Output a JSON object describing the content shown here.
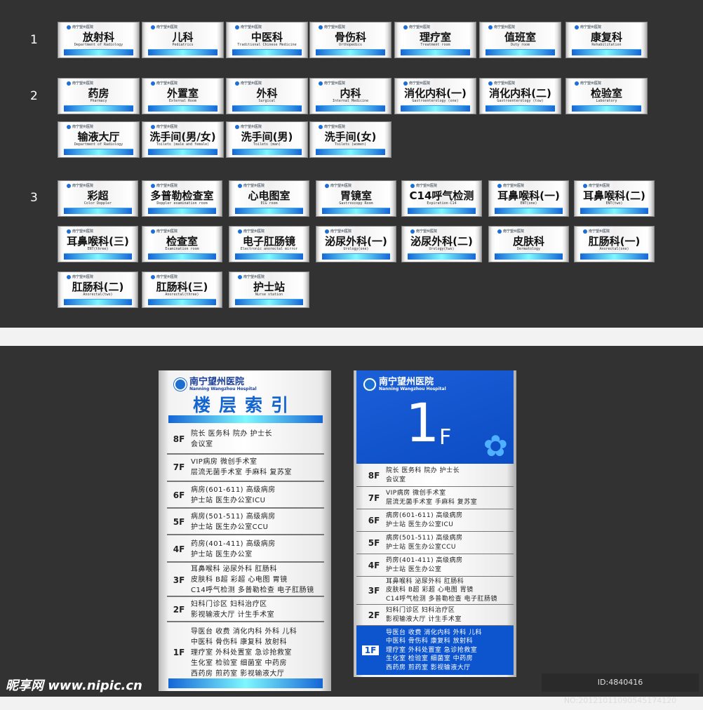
{
  "row_labels": [
    "1",
    "2",
    "3"
  ],
  "hospital": {
    "name_cn": "南宁望州医院",
    "name_en": "Nanning Wangzhou Hospital"
  },
  "door_signs": {
    "group1": [
      {
        "title": "放射科",
        "sub": "Department of Radiology"
      },
      {
        "title": "儿科",
        "sub": "Pediatrics"
      },
      {
        "title": "中医科",
        "sub": "Traditional Chinese Medicine"
      },
      {
        "title": "骨伤科",
        "sub": "Orthopedics"
      },
      {
        "title": "理疗室",
        "sub": "Treatment room"
      },
      {
        "title": "值班室",
        "sub": "Duty room"
      },
      {
        "title": "康复科",
        "sub": "Rehabilitation"
      }
    ],
    "group2": [
      {
        "title": "药房",
        "sub": "Pharmacy"
      },
      {
        "title": "外置室",
        "sub": "External Room"
      },
      {
        "title": "外科",
        "sub": "Surgical"
      },
      {
        "title": "内科",
        "sub": "Internal Medicine"
      },
      {
        "title": "消化内科(一)",
        "sub": "Gastroenterology (one)"
      },
      {
        "title": "消化内科(二)",
        "sub": "Gastroenterology (tow)"
      },
      {
        "title": "检验室",
        "sub": "Laboratory"
      },
      {
        "title": "输液大厅",
        "sub": "Department of Radiology"
      },
      {
        "title": "洗手间(男/女)",
        "sub": "Toilets (male and female)"
      },
      {
        "title": "洗手间(男)",
        "sub": "Toilets (man)"
      },
      {
        "title": "洗手间(女)",
        "sub": "Toilets (women)"
      }
    ],
    "group3": [
      {
        "title": "彩超",
        "sub": "Color Doppler"
      },
      {
        "title": "多普勒检查室",
        "sub": "Doppler examination room"
      },
      {
        "title": "心电图室",
        "sub": "ECG room"
      },
      {
        "title": "胃镜室",
        "sub": "Gastroscopy Room"
      },
      {
        "title": "C14呼气检测",
        "sub": "Expiration-C14"
      },
      {
        "title": "耳鼻喉科(一)",
        "sub": "ENT(one)"
      },
      {
        "title": "耳鼻喉科(二)",
        "sub": "ENT(two)"
      },
      {
        "title": "耳鼻喉科(三)",
        "sub": "ENT(three)"
      },
      {
        "title": "检查室",
        "sub": "Examination room"
      },
      {
        "title": "电子肛肠镜",
        "sub": "Electronic anorectal mirror"
      },
      {
        "title": "泌尿外科(一)",
        "sub": "Urology(one)"
      },
      {
        "title": "泌尿外科(二)",
        "sub": "Urology(two)"
      },
      {
        "title": "皮肤科",
        "sub": "Dermatology"
      },
      {
        "title": "肛肠科(一)",
        "sub": "Anorectal(one)"
      },
      {
        "title": "肛肠科(二)",
        "sub": "Anorectal(two)"
      },
      {
        "title": "肛肠科(三)",
        "sub": "Anorectal(three)"
      },
      {
        "title": "护士站",
        "sub": "Nurse station"
      }
    ]
  },
  "directory": {
    "title": "楼层索引",
    "current_floor_number": "1",
    "current_floor_suffix": "F",
    "floors": [
      {
        "floor": "8F",
        "lines": [
          "院长  医务科  院办  护士长",
          "会议室"
        ]
      },
      {
        "floor": "7F",
        "lines": [
          "VIP病房  微创手术室",
          "层流无菌手术室  手麻科  复苏室"
        ]
      },
      {
        "floor": "6F",
        "lines": [
          "病房(601-611)  高级病房",
          "护士站  医生办公室ICU"
        ]
      },
      {
        "floor": "5F",
        "lines": [
          "病房(501-511)  高级病房",
          "护士站  医生办公室CCU"
        ]
      },
      {
        "floor": "4F",
        "lines": [
          "药房(401-411)  高级病房",
          "护士站  医生办公室"
        ]
      },
      {
        "floor": "3F",
        "lines": [
          "耳鼻喉科  泌尿外科  肛肠科",
          "皮肤科  B超  彩超  心电图  胃镜",
          "C14呼气检测 多普勒检查 电子肛肠镜"
        ]
      },
      {
        "floor": "2F",
        "lines": [
          "妇科门诊区    妇科治疗区",
          "影视输液大厅  计生手术室"
        ]
      },
      {
        "floor": "1F",
        "lines": [
          "导医台  收费  消化内科  外科  儿科",
          "中医科  骨伤科  康复科  放射科",
          "理疗室  外科处置室  急诊抢救室",
          "生化室  检验室  细菌室  中药房",
          "西药房  煎药室  影视输液大厅"
        ]
      }
    ]
  },
  "watermark": "昵享网 www.nipic.cn",
  "image_id": "ID:4840416 NO:20121011090545174120",
  "colors": {
    "background": "#323232",
    "accent_blue": "#1566d6",
    "highlight_cyan": "#7ef8ff"
  }
}
